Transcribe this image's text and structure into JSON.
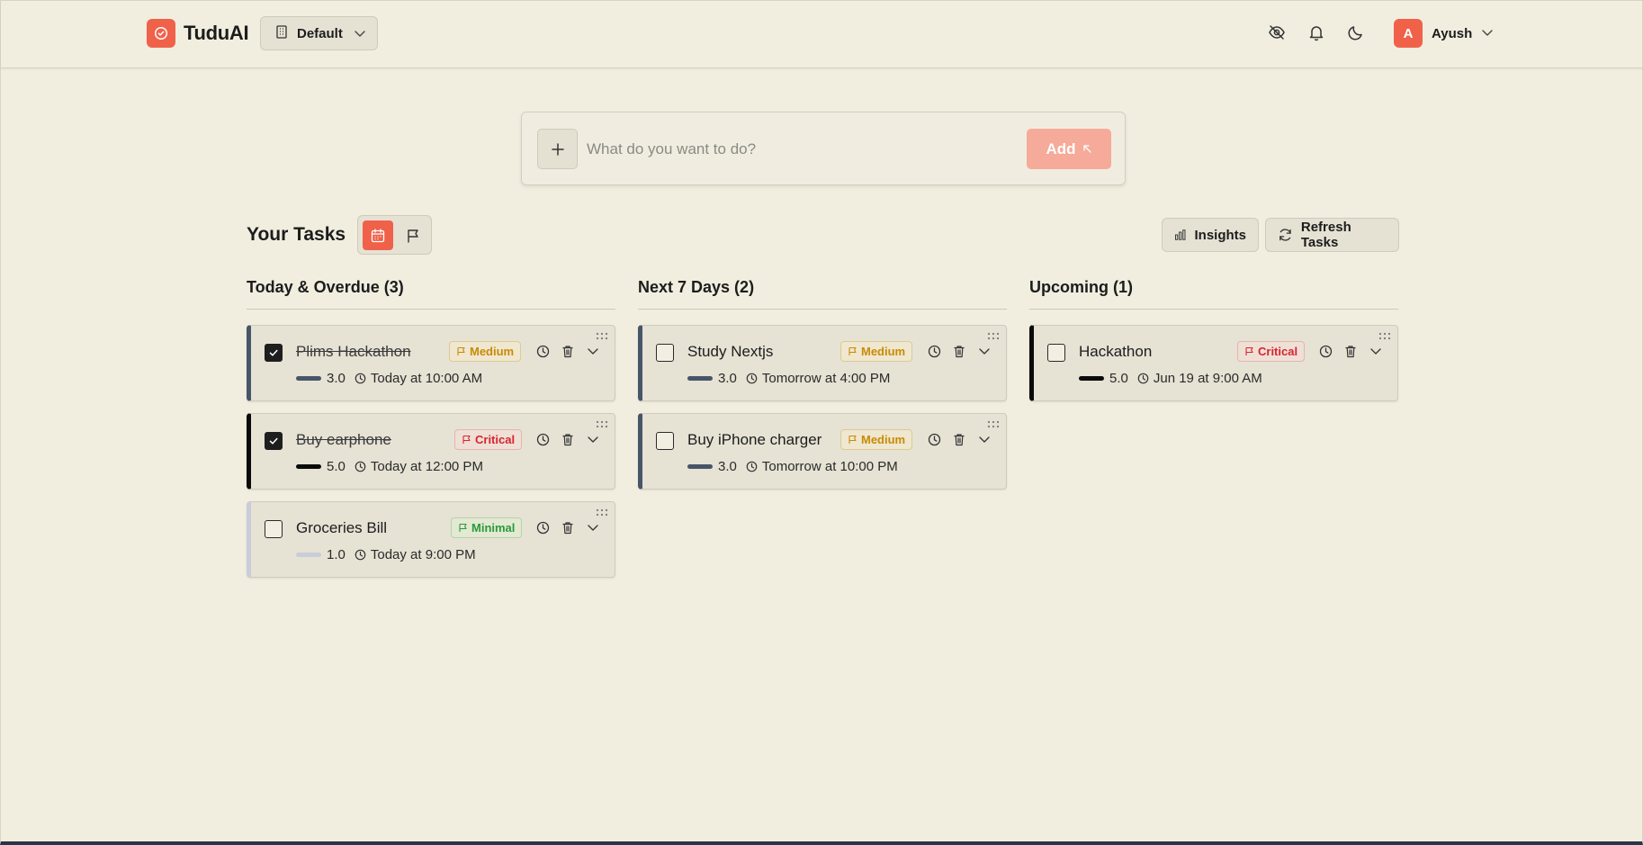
{
  "header": {
    "app_name": "TuduAI",
    "workspace": "Default",
    "user_initial": "A",
    "user_name": "Ayush"
  },
  "add_task": {
    "placeholder": "What do you want to do?",
    "add_label": "Add"
  },
  "tasks": {
    "title": "Your Tasks",
    "insights_label": "Insights",
    "refresh_label": "Refresh Tasks"
  },
  "colors": {
    "accent": "#f0614a",
    "background": "#f1eedf",
    "card": "#e6e2d4",
    "medium": "#c98a06",
    "critical": "#d92330",
    "minimal": "#2a9a3b"
  },
  "columns": [
    {
      "title": "Today & Overdue (3)",
      "tasks": [
        {
          "name": "Plims Hackathon",
          "done": true,
          "priority": "Medium",
          "score": "3.0",
          "due": "Today at 10:00 AM"
        },
        {
          "name": "Buy earphone",
          "done": true,
          "priority": "Critical",
          "score": "5.0",
          "due": "Today at 12:00 PM"
        },
        {
          "name": "Groceries Bill",
          "done": false,
          "priority": "Minimal",
          "score": "1.0",
          "due": "Today at 9:00 PM"
        }
      ]
    },
    {
      "title": "Next 7 Days (2)",
      "tasks": [
        {
          "name": "Study Nextjs",
          "done": false,
          "priority": "Medium",
          "score": "3.0",
          "due": "Tomorrow at 4:00 PM"
        },
        {
          "name": "Buy iPhone charger",
          "done": false,
          "priority": "Medium",
          "score": "3.0",
          "due": "Tomorrow at 10:00 PM"
        }
      ]
    },
    {
      "title": "Upcoming (1)",
      "tasks": [
        {
          "name": "Hackathon",
          "done": false,
          "priority": "Critical",
          "score": "5.0",
          "due": "Jun 19 at 9:00 AM"
        }
      ]
    }
  ]
}
